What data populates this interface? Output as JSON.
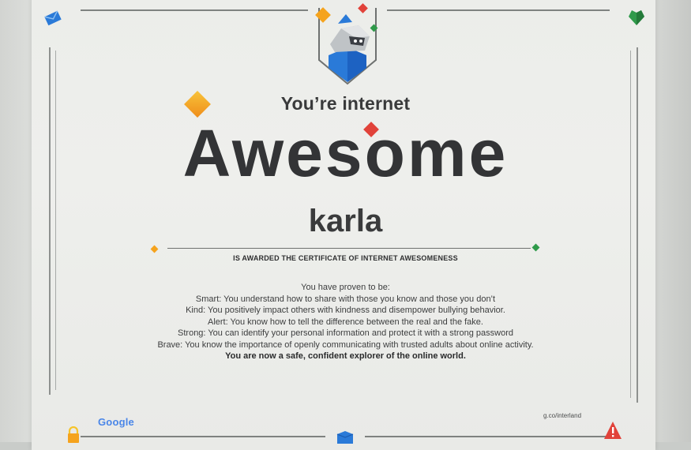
{
  "certificate": {
    "headline_small": "You’re internet",
    "headline_big": "Awesome",
    "recipient": "karla",
    "award_line": "IS AWARDED THE CERTIFICATE OF INTERNET AWESOMENESS",
    "intro": "You have proven to be:",
    "traits": [
      "Smart: You understand how to share with those you know and those you don’t",
      "Kind: You positively impact others with kindness and disempower bullying behavior.",
      "Alert: You know how to tell the difference between the real and the fake.",
      "Strong: You can identify your personal information and protect it with a strong password",
      "Brave: You know the importance of openly communicating with trusted adults about online activity."
    ],
    "closing": "You are now a safe, confident explorer of the online world.",
    "footer_logo": "Google",
    "footer_url": "g.co/interland"
  },
  "colors": {
    "blue": "#2a7ad8",
    "green": "#2f9a4a",
    "red": "#e1423a",
    "orange": "#f5a31d",
    "yellow": "#f6c42a",
    "text": "#393a3b"
  },
  "icons": [
    "envelope-icon",
    "heart-gem-icon",
    "lock-icon",
    "warning-icon",
    "cube-icon",
    "mascot-icon"
  ]
}
